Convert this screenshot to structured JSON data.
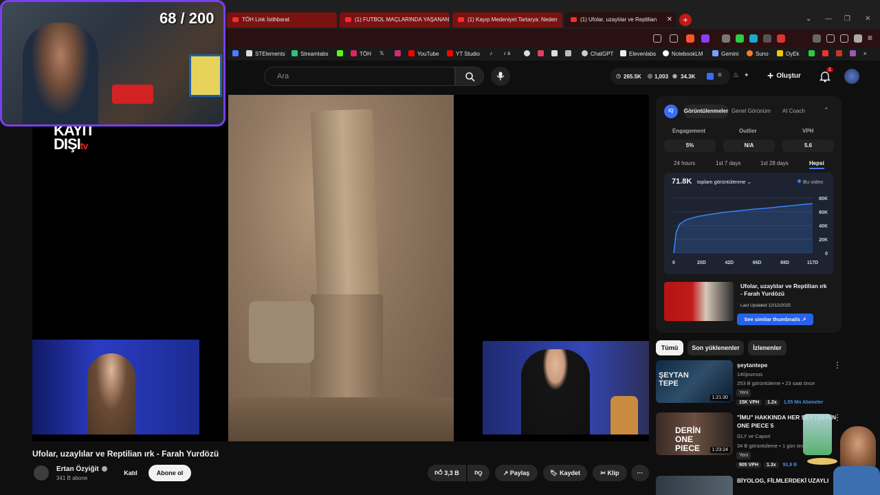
{
  "browser": {
    "tabs": [
      {
        "label": "TÖH Link İstihbarat",
        "active": false
      },
      {
        "label": "(1) FUTBOL MAÇLARINDA YAŞANAN",
        "active": false
      },
      {
        "label": "(1) Kayıp Medeniyet Tartarya: Neden",
        "active": false
      },
      {
        "label": "(1) Ufolar, uzaylılar ve Reptilian ı",
        "active": true
      }
    ],
    "new_tab": "+",
    "bookmarks": [
      "STElements",
      "Streamlabs",
      "TÖH",
      "YouTube",
      "YT Studio",
      "s",
      "ChatGPT",
      "Elevenlabs",
      "NotebookLM",
      "Gemini",
      "Suno",
      "OyEk"
    ],
    "accent": "#ff2b2b"
  },
  "overlay": {
    "counter": "68 / 200",
    "logo_line1": "KAYIT",
    "logo_line2": "DIŞI",
    "logo_suffix": "tv"
  },
  "header": {
    "search_placeholder": "Ara",
    "stats": {
      "views": "265.5K",
      "comments": "1,003",
      "eye": "34.3K"
    },
    "create_label": "Oluştur",
    "notif_count": "1"
  },
  "video": {
    "title": "Ufolar, uzaylılar ve Reptilian ırk - Farah Yurdözü",
    "channel": "Ertan Özyiğit",
    "subscribers": "341 B abone",
    "join_label": "Katıl",
    "subscribe_label": "Abone ol",
    "likes": "3,3 B",
    "share_label": "Paylaş",
    "save_label": "Kaydet",
    "clip_label": "Klip",
    "more": "···"
  },
  "iq_panel": {
    "logo": "IQ",
    "tabs": [
      "Görüntülenmeler",
      "Genel Görünüm",
      "AI Coach"
    ],
    "stats": [
      {
        "label": "Engagement",
        "value": "5%"
      },
      {
        "label": "Outlier",
        "value": "N/A"
      },
      {
        "label": "VPH",
        "value": "5.6"
      }
    ],
    "ranges": [
      "24 hours",
      "1st 7 days",
      "1st 28 days",
      "Hepsi"
    ],
    "total": "71.8K",
    "metric_select": "toplam görüntülenme",
    "legend": "Bu video",
    "thumb_title": "Ufolar, uzaylılar ve Reptilian ırk - Farah Yurdözü",
    "last_updated": "Last Updated 12/12/2025",
    "similar_label": "See similar thumbnails"
  },
  "chart_data": {
    "type": "area",
    "x_ticks": [
      "0",
      "20D",
      "42D",
      "66D",
      "88D",
      "117D"
    ],
    "y_ticks": [
      "0",
      "20K",
      "40K",
      "60K",
      "80K"
    ],
    "ylim": [
      0,
      80000
    ],
    "xlim": [
      0,
      117
    ],
    "series": [
      {
        "name": "Bu video",
        "x": [
          0,
          2,
          5,
          10,
          20,
          30,
          42,
          55,
          66,
          80,
          88,
          100,
          110,
          117
        ],
        "values": [
          0,
          30000,
          42000,
          48000,
          53000,
          56000,
          59000,
          61500,
          63500,
          65500,
          67000,
          69000,
          70800,
          71800
        ]
      }
    ]
  },
  "sidebar": {
    "chips": [
      "Tümü",
      "Son yüklenenler",
      "İzlenenler"
    ],
    "items": [
      {
        "title": "şeytantepe",
        "channel": "140journos",
        "meta": "253 B görüntüleme • 23 saat önce",
        "badge": "Yeni",
        "duration": "1:21:30",
        "vph": "15K VPH",
        "mult": "1.2x",
        "subs": "1,55 Mn Aboneler",
        "thumb_text": "ŞEYTAN TEPE"
      },
      {
        "title": "\"İMU\" HAKKINDA HER ŞEY | DERİN ONE PIECE 5",
        "channel": "GLY ve Capori",
        "meta": "34 B görüntüleme • 1 gün önce",
        "badge": "Yeni",
        "duration": "1:23:24",
        "vph": "905 VPH",
        "mult": "1.3x",
        "subs": "91,9 B",
        "thumb_text": "DERİN ONE PIECE"
      },
      {
        "title": "BİYOLOG, FİLMLERDEKİ UZAYLI",
        "channel": "",
        "meta": "",
        "badge": "",
        "duration": "",
        "vph": "",
        "mult": "",
        "subs": "",
        "thumb_text": ""
      }
    ]
  }
}
